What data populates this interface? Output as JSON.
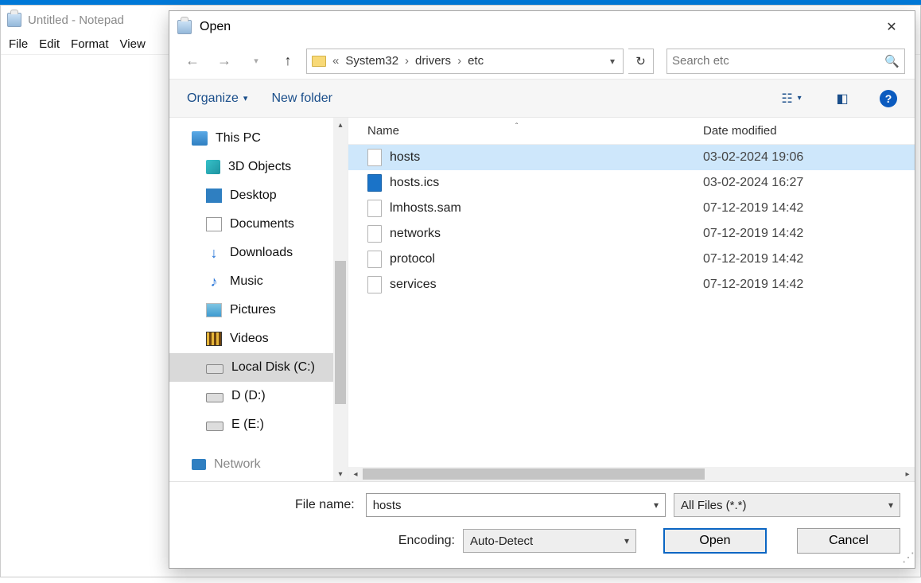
{
  "notepad": {
    "title": "Untitled - Notepad",
    "menu": [
      "File",
      "Edit",
      "Format",
      "View"
    ]
  },
  "dialog": {
    "title": "Open",
    "breadcrumb": {
      "prefix": "«",
      "parts": [
        "System32",
        "drivers",
        "etc"
      ]
    },
    "search_placeholder": "Search etc",
    "toolbar": {
      "organize": "Organize",
      "new_folder": "New folder"
    },
    "tree": [
      {
        "label": "This PC",
        "icon": "pc",
        "sub": false,
        "sel": false
      },
      {
        "label": "3D Objects",
        "icon": "cube",
        "sub": true,
        "sel": false
      },
      {
        "label": "Desktop",
        "icon": "desk",
        "sub": true,
        "sel": false
      },
      {
        "label": "Documents",
        "icon": "doc",
        "sub": true,
        "sel": false
      },
      {
        "label": "Downloads",
        "icon": "dl",
        "sub": true,
        "sel": false
      },
      {
        "label": "Music",
        "icon": "music",
        "sub": true,
        "sel": false
      },
      {
        "label": "Pictures",
        "icon": "pic",
        "sub": true,
        "sel": false
      },
      {
        "label": "Videos",
        "icon": "vid",
        "sub": true,
        "sel": false
      },
      {
        "label": "Local Disk (C:)",
        "icon": "drv",
        "sub": true,
        "sel": true
      },
      {
        "label": "D (D:)",
        "icon": "drv",
        "sub": true,
        "sel": false
      },
      {
        "label": "E (E:)",
        "icon": "drv",
        "sub": true,
        "sel": false
      },
      {
        "label": "Network",
        "icon": "net",
        "sub": false,
        "sel": false,
        "faded": true
      }
    ],
    "columns": {
      "name": "Name",
      "date": "Date modified"
    },
    "files": [
      {
        "name": "hosts",
        "date": "03-02-2024 19:06",
        "icon": "file",
        "sel": true
      },
      {
        "name": "hosts.ics",
        "date": "03-02-2024 16:27",
        "icon": "cal",
        "sel": false
      },
      {
        "name": "lmhosts.sam",
        "date": "07-12-2019 14:42",
        "icon": "file",
        "sel": false
      },
      {
        "name": "networks",
        "date": "07-12-2019 14:42",
        "icon": "file",
        "sel": false
      },
      {
        "name": "protocol",
        "date": "07-12-2019 14:42",
        "icon": "file",
        "sel": false
      },
      {
        "name": "services",
        "date": "07-12-2019 14:42",
        "icon": "file",
        "sel": false
      }
    ],
    "filename_label": "File name:",
    "filename_value": "hosts",
    "filter_value": "All Files  (*.*)",
    "encoding_label": "Encoding:",
    "encoding_value": "Auto-Detect",
    "open_label": "Open",
    "cancel_label": "Cancel"
  }
}
